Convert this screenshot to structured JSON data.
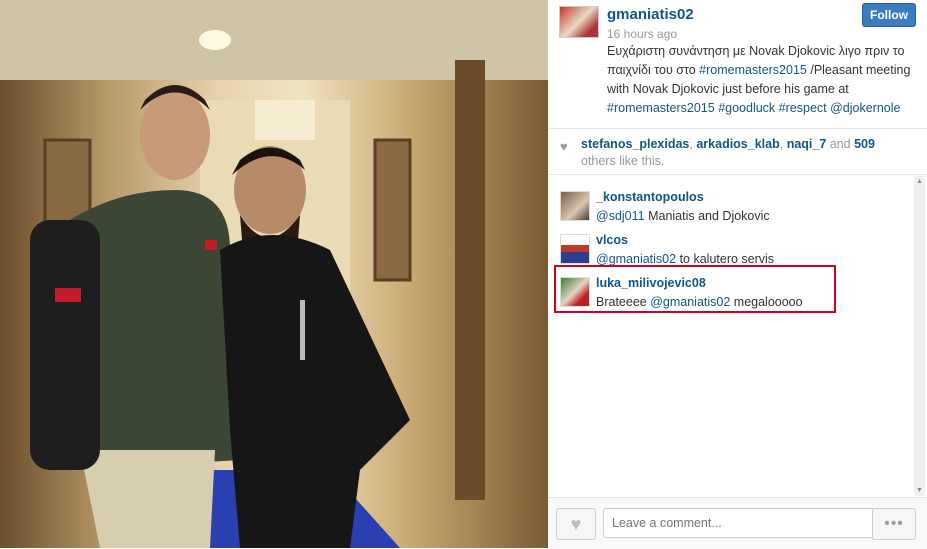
{
  "post": {
    "username": "gmaniatis02",
    "time": "16 hours ago",
    "follow_label": "Follow",
    "caption_greek": "Ευχάριστη συνάντηση με Novak Djokovic λιγο πριν το παιχνίδι του στο ",
    "caption_tag1": "#romemasters2015",
    "caption_english": " /Pleasant meeting with Novak Djokovic just before his game at ",
    "caption_tag2": "#romemasters2015",
    "caption_tag3": "#goodluck",
    "caption_tag4": "#respect",
    "caption_tag5": "@djokernole"
  },
  "likes": {
    "user1": "stefanos_plexidas",
    "user2": "arkadios_klab",
    "user3": "naqi_7",
    "and_text": " and ",
    "count": "509",
    "suffix": " others like this."
  },
  "comments": [
    {
      "user": "_konstantopoulos",
      "mention": "@sdj011",
      "text": " Maniatis and Djokovic"
    },
    {
      "user": "vlcos",
      "mention": "@gmaniatis02",
      "text": " to kalutero servis"
    },
    {
      "user": "luka_milivojevic08",
      "prefix": "Brateeee ",
      "mention": "@gmaniatis02",
      "text": " megalooooo"
    }
  ],
  "footer": {
    "comment_placeholder": "Leave a comment...",
    "more_label": "•••"
  },
  "icons": {
    "heart": "heart-icon",
    "more": "more-options-icon"
  },
  "colors": {
    "link": "#125688",
    "follow_button": "#3b7bbf",
    "highlight": "#d0021b"
  }
}
